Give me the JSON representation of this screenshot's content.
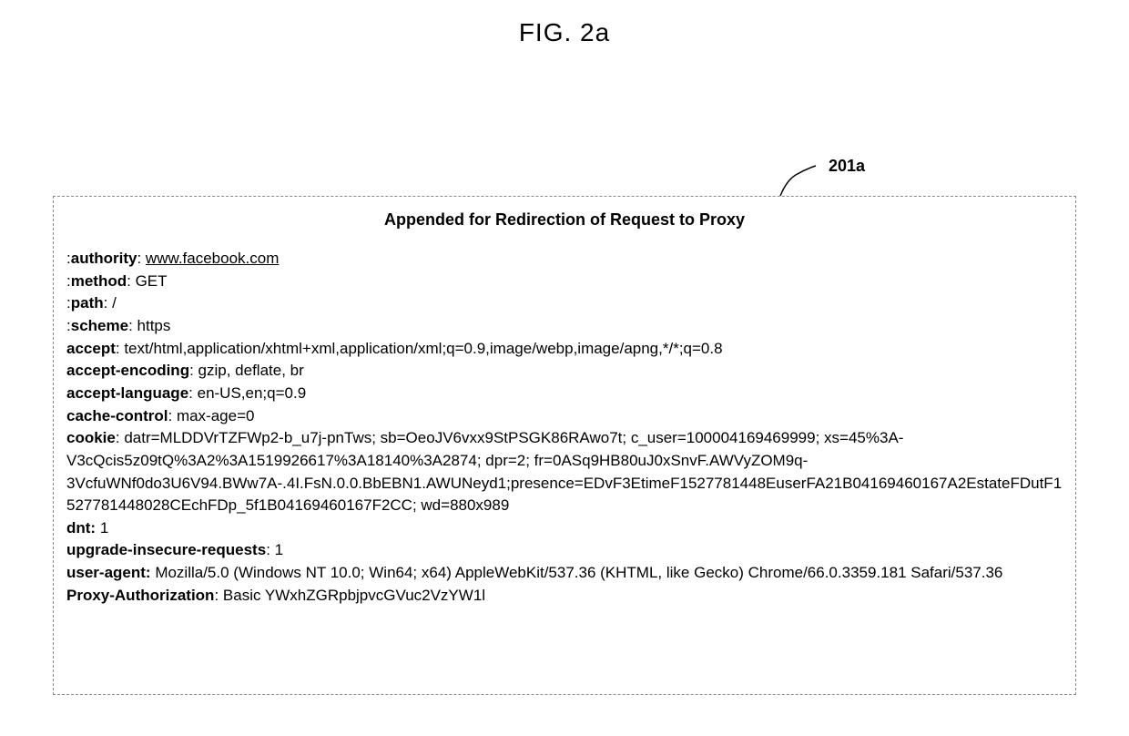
{
  "figure": {
    "title": "FIG. 2a",
    "reference_label": "201a"
  },
  "box": {
    "title": "Appended for Redirection of Request  to Proxy"
  },
  "headers": {
    "authority": {
      "prefix": ":",
      "name": "authority",
      "sep": ": ",
      "value": "www.facebook.com"
    },
    "method": {
      "prefix": ":",
      "name": "method",
      "sep": ": ",
      "value": "GET"
    },
    "path": {
      "prefix": ":",
      "name": "path",
      "sep": ": ",
      "value": "/"
    },
    "scheme": {
      "prefix": ":",
      "name": "scheme",
      "sep": ": ",
      "value": "https"
    },
    "accept": {
      "name": "accept",
      "sep": ": ",
      "value": "text/html,application/xhtml+xml,application/xml;q=0.9,image/webp,image/apng,*/*;q=0.8"
    },
    "accept_encoding": {
      "name": "accept-encoding",
      "sep": ": ",
      "value": "gzip, deflate, br"
    },
    "accept_language": {
      "name": "accept-language",
      "sep": ": ",
      "value": "en-US,en;q=0.9"
    },
    "cache_control": {
      "name": "cache-control",
      "sep": ": ",
      "value": "max-age=0"
    },
    "cookie": {
      "name": "cookie",
      "sep": ": ",
      "value": "datr=MLDDVrTZFWp2-b_u7j-pnTws; sb=OeoJV6vxx9StPSGK86RAwo7t; c_user=100004169469999; xs=45%3A-V3cQcis5z09tQ%3A2%3A1519926617%3A18140%3A2874; dpr=2; fr=0ASq9HB80uJ0xSnvF.AWVyZOM9q-3VcfuWNf0do3U6V94.BWw7A-.4I.FsN.0.0.BbEBN1.AWUNeyd1;presence=EDvF3EtimeF1527781448EuserFA21B04169460167A2EstateFDutF1527781448028CEchFDp_5f1B04169460167F2CC; wd=880x989"
    },
    "dnt": {
      "name": "dnt:",
      "sep": " ",
      "value": "1"
    },
    "upgrade_insecure_requests": {
      "name": "upgrade-insecure-requests",
      "sep": ": ",
      "value": "1"
    },
    "user_agent": {
      "name": "user-agent:",
      "sep": " ",
      "value": "Mozilla/5.0 (Windows NT 10.0; Win64; x64) AppleWebKit/537.36 (KHTML, like Gecko) Chrome/66.0.3359.181 Safari/537.36"
    },
    "proxy_authorization": {
      "name": "Proxy-Authorization",
      "sep": ": ",
      "value": "Basic YWxhZGRpbjpvcGVuc2VzYW1l"
    }
  }
}
